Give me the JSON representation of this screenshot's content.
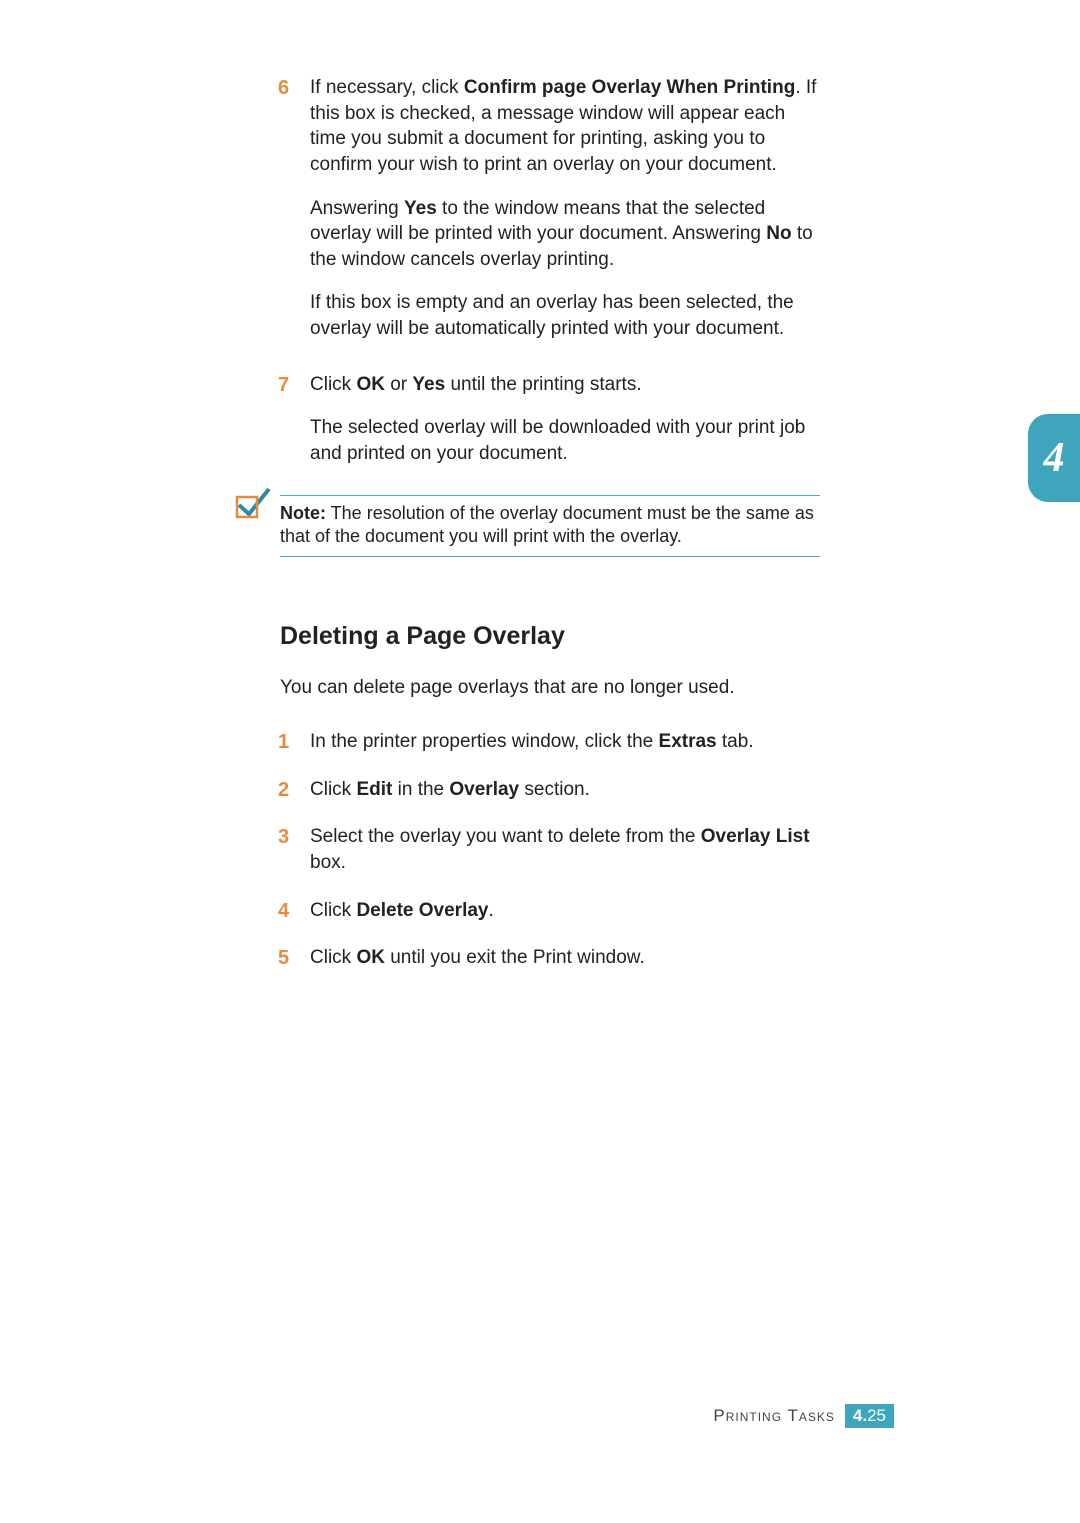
{
  "sideTab": {
    "chapter": "4"
  },
  "top": {
    "step6": {
      "num": "6",
      "p1_a": "If necessary, click ",
      "p1_bold": "Confirm page Overlay When Printing",
      "p1_b": ". If this box is checked, a message window will appear each time you submit a document for printing, asking you to confirm your wish to print an overlay on your document.",
      "p2_a": "Answering ",
      "p2_yes": "Yes",
      "p2_b": " to the window means that the selected overlay will be printed with your document. Answering ",
      "p2_no": "No",
      "p2_c": " to the window cancels overlay printing.",
      "p3": "If this box is empty and an overlay has been selected, the overlay will be automatically printed with your document."
    },
    "step7": {
      "num": "7",
      "p1_a": "Click ",
      "p1_ok": "OK",
      "p1_b": " or ",
      "p1_yes": "Yes",
      "p1_c": " until the printing starts.",
      "p2": "The selected overlay will be downloaded with your print job and printed on your document."
    }
  },
  "note": {
    "label": "Note:",
    "text": " The resolution of the overlay document must be the same as that of the document you will print with the overlay."
  },
  "section": {
    "title": "Deleting a Page Overlay",
    "intro": "You can delete page overlays that are no longer used."
  },
  "delSteps": {
    "s1": {
      "num": "1",
      "a": "In the printer properties window, click the ",
      "b": "Extras",
      "c": " tab."
    },
    "s2": {
      "num": "2",
      "a": "Click ",
      "b": "Edit",
      "c": " in the ",
      "d": "Overlay",
      "e": " section."
    },
    "s3": {
      "num": "3",
      "a": "Select the overlay you want to delete from the ",
      "b": "Overlay List",
      "c": " box."
    },
    "s4": {
      "num": "4",
      "a": "Click ",
      "b": "Delete Overlay",
      "c": "."
    },
    "s5": {
      "num": "5",
      "a": "Click ",
      "b": "OK",
      "c": " until you exit the Print window."
    }
  },
  "footer": {
    "label": "Printing Tasks",
    "chapter": "4.",
    "page": "25"
  }
}
